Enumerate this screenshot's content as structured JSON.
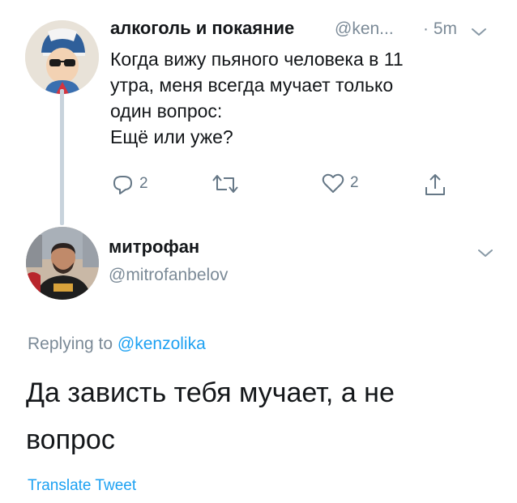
{
  "tweet1": {
    "author_name": "алкоголь и покаяние",
    "author_handle": "@ken...",
    "time": "· 5m",
    "text_lines": [
      "Когда вижу пьяного человека в 11",
      "утра, меня всегда мучает только",
      "один вопрос:",
      "Ещё или уже?"
    ],
    "avatar_icon": "cartoon-character-avatar",
    "actions": {
      "reply_count": "2",
      "retweet_count": "",
      "like_count": "2"
    }
  },
  "tweet2": {
    "author_name": "митрофан",
    "author_handle": "@mitrofanbelov",
    "avatar_icon": "man-photo-avatar",
    "replying_prefix": "Replying to",
    "replying_mention": "@kenzolika",
    "text_lines": [
      "Да зависть тебя мучает, а не",
      "вопрос"
    ],
    "translate_label": "Translate Tweet"
  },
  "colors": {
    "text": "#14171a",
    "secondary": "#7b8a97",
    "link": "#1da1f2",
    "thread_line": "#c8d3dc"
  }
}
